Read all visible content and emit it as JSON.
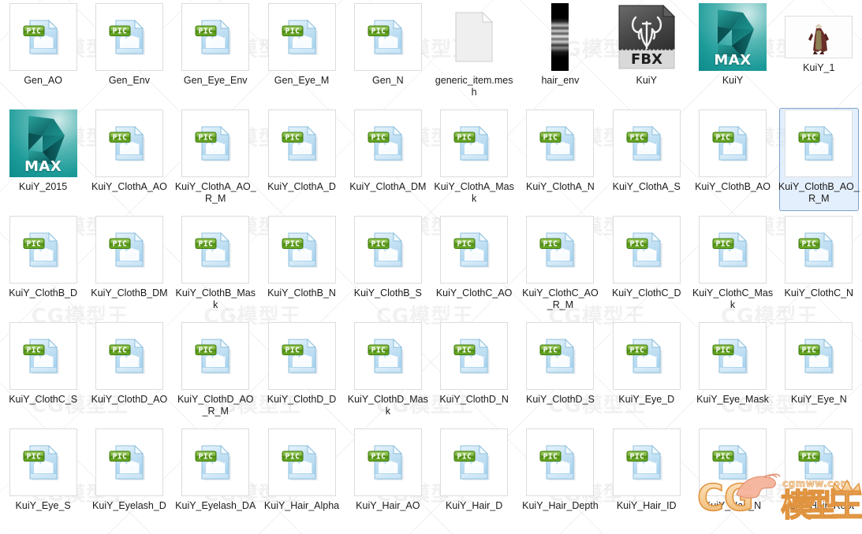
{
  "window": {
    "view_mode": "large-icons-grid",
    "columns": 10,
    "rows": 5,
    "background_color": "#ffffff",
    "selection_color": "#cde2fc",
    "selection_border_color": "#7da2ce",
    "label_color": "#1a1a1a"
  },
  "watermark": {
    "ghost_text": "CG模型王",
    "logo_text": "CG",
    "logo_text_cn": "模型王",
    "logo_domain": "cgmww.com",
    "logo_color": "#f4c58a",
    "logo_outline_color": "#e2913f"
  },
  "items": [
    {
      "name": "Gen_AO",
      "icon": "pic-file-icon",
      "selected": false
    },
    {
      "name": "Gen_Env",
      "icon": "pic-file-icon",
      "selected": false
    },
    {
      "name": "Gen_Eye_Env",
      "icon": "pic-file-icon",
      "selected": false
    },
    {
      "name": "Gen_Eye_M",
      "icon": "pic-file-icon",
      "selected": false
    },
    {
      "name": "Gen_N",
      "icon": "pic-file-icon",
      "selected": false
    },
    {
      "name": "generic_item.mesh",
      "icon": "generic-file-icon",
      "selected": false
    },
    {
      "name": "hair_env",
      "icon": "image-thumbnail-hair-env",
      "selected": false
    },
    {
      "name": "KuiY",
      "icon": "fbx-file-icon",
      "selected": false
    },
    {
      "name": "KuiY",
      "icon": "max-file-icon",
      "selected": false
    },
    {
      "name": "KuiY_1",
      "icon": "image-thumbnail-character",
      "selected": false
    },
    {
      "name": "KuiY_2015",
      "icon": "max-file-icon",
      "selected": false
    },
    {
      "name": "KuiY_ClothA_AO",
      "icon": "pic-file-icon",
      "selected": false
    },
    {
      "name": "KuiY_ClothA_AO_R_M",
      "icon": "pic-file-icon",
      "selected": false
    },
    {
      "name": "KuiY_ClothA_D",
      "icon": "pic-file-icon",
      "selected": false
    },
    {
      "name": "KuiY_ClothA_DM",
      "icon": "pic-file-icon",
      "selected": false
    },
    {
      "name": "KuiY_ClothA_Mask",
      "icon": "pic-file-icon",
      "selected": false
    },
    {
      "name": "KuiY_ClothA_N",
      "icon": "pic-file-icon",
      "selected": false
    },
    {
      "name": "KuiY_ClothA_S",
      "icon": "pic-file-icon",
      "selected": false
    },
    {
      "name": "KuiY_ClothB_AO",
      "icon": "pic-file-icon",
      "selected": false
    },
    {
      "name": "KuiY_ClothB_AO_R_M",
      "icon": "pic-file-icon",
      "selected": true
    },
    {
      "name": "KuiY_ClothB_D",
      "icon": "pic-file-icon",
      "selected": false
    },
    {
      "name": "KuiY_ClothB_DM",
      "icon": "pic-file-icon",
      "selected": false
    },
    {
      "name": "KuiY_ClothB_Mask",
      "icon": "pic-file-icon",
      "selected": false
    },
    {
      "name": "KuiY_ClothB_N",
      "icon": "pic-file-icon",
      "selected": false
    },
    {
      "name": "KuiY_ClothB_S",
      "icon": "pic-file-icon",
      "selected": false
    },
    {
      "name": "KuiY_ClothC_AO",
      "icon": "pic-file-icon",
      "selected": false
    },
    {
      "name": "KuiY_ClothC_AO_R_M",
      "icon": "pic-file-icon",
      "selected": false
    },
    {
      "name": "KuiY_ClothC_D",
      "icon": "pic-file-icon",
      "selected": false
    },
    {
      "name": "KuiY_ClothC_Mask",
      "icon": "pic-file-icon",
      "selected": false
    },
    {
      "name": "KuiY_ClothC_N",
      "icon": "pic-file-icon",
      "selected": false
    },
    {
      "name": "KuiY_ClothC_S",
      "icon": "pic-file-icon",
      "selected": false
    },
    {
      "name": "KuiY_ClothD_AO",
      "icon": "pic-file-icon",
      "selected": false
    },
    {
      "name": "KuiY_ClothD_AO_R_M",
      "icon": "pic-file-icon",
      "selected": false
    },
    {
      "name": "KuiY_ClothD_D",
      "icon": "pic-file-icon",
      "selected": false
    },
    {
      "name": "KuiY_ClothD_Mask",
      "icon": "pic-file-icon",
      "selected": false
    },
    {
      "name": "KuiY_ClothD_N",
      "icon": "pic-file-icon",
      "selected": false
    },
    {
      "name": "KuiY_ClothD_S",
      "icon": "pic-file-icon",
      "selected": false
    },
    {
      "name": "KuiY_Eye_D",
      "icon": "pic-file-icon",
      "selected": false
    },
    {
      "name": "KuiY_Eye_Mask",
      "icon": "pic-file-icon",
      "selected": false
    },
    {
      "name": "KuiY_Eye_N",
      "icon": "pic-file-icon",
      "selected": false
    },
    {
      "name": "KuiY_Eye_S",
      "icon": "pic-file-icon",
      "selected": false
    },
    {
      "name": "KuiY_Eyelash_D",
      "icon": "pic-file-icon",
      "selected": false
    },
    {
      "name": "KuiY_Eyelash_DA",
      "icon": "pic-file-icon",
      "selected": false
    },
    {
      "name": "KuiY_Hair_Alpha",
      "icon": "pic-file-icon",
      "selected": false
    },
    {
      "name": "KuiY_Hair_AO",
      "icon": "pic-file-icon",
      "selected": false
    },
    {
      "name": "KuiY_Hair_D",
      "icon": "pic-file-icon",
      "selected": false
    },
    {
      "name": "KuiY_Hair_Depth",
      "icon": "pic-file-icon",
      "selected": false
    },
    {
      "name": "KuiY_Hair_ID",
      "icon": "pic-file-icon",
      "selected": false
    },
    {
      "name": "KuiY_Hair_N",
      "icon": "pic-file-icon",
      "selected": false
    },
    {
      "name": "KuiY_Hair_Root",
      "icon": "pic-file-icon",
      "selected": false
    }
  ],
  "icon_badges": {
    "pic_badge_label": "PIC",
    "fbx_label": "FBX",
    "max_label": "MAX"
  }
}
